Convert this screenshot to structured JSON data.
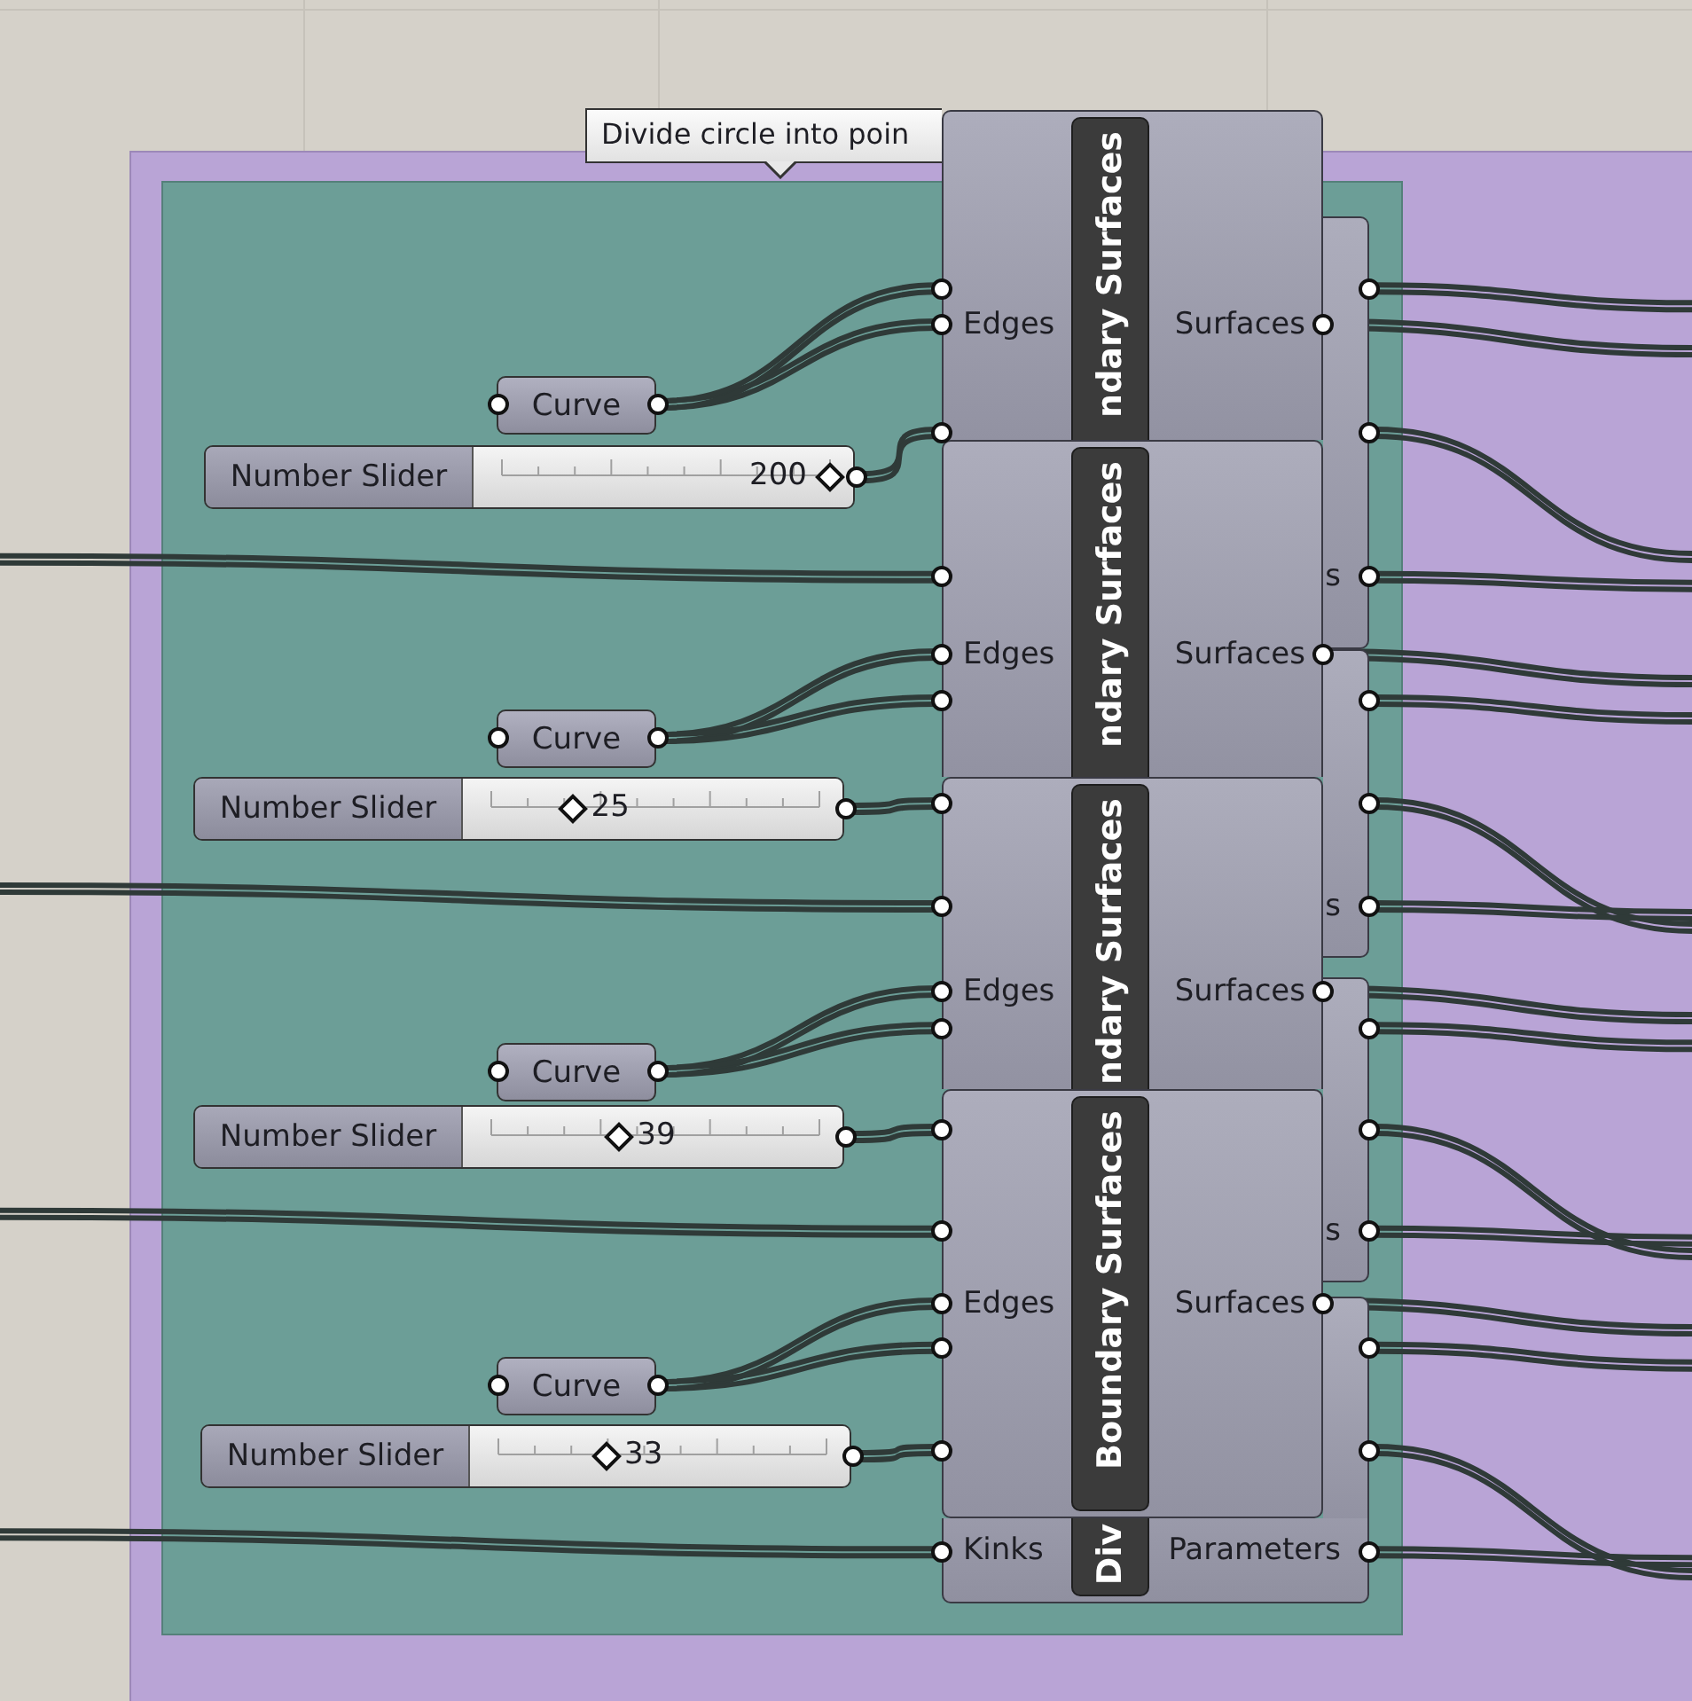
{
  "tooltip": {
    "text": "Divide circle into poin"
  },
  "groups": [
    {
      "kind": "outer",
      "color": "#b9a4d6"
    },
    {
      "kind": "inner",
      "color": "#6c9e97"
    }
  ],
  "inputs": [
    {
      "curve": "Curve",
      "slider": {
        "label": "Number Slider",
        "value": "200",
        "level": 1.0
      }
    },
    {
      "curve": "Curve",
      "slider": {
        "label": "Number Slider",
        "value": "25",
        "level": 0.25
      }
    },
    {
      "curve": "Curve",
      "slider": {
        "label": "Number Slider",
        "value": "39",
        "level": 0.39
      }
    },
    {
      "curve": "Curve",
      "slider": {
        "label": "Number Slider",
        "value": "33",
        "level": 0.33
      }
    }
  ],
  "divide_components": [
    {
      "output": "s"
    },
    {
      "output": "s"
    },
    {
      "output": "s"
    },
    {
      "title": "Div",
      "input": "Kinks",
      "output": "Parameters"
    }
  ],
  "boundary_components": [
    {
      "title": "ndary Surfaces",
      "input": "Edges",
      "output": "Surfaces"
    },
    {
      "title": "ndary Surfaces",
      "input": "Edges",
      "output": "Surfaces"
    },
    {
      "title": "ndary Surfaces",
      "input": "Edges",
      "output": "Surfaces"
    },
    {
      "title": "Boundary Surfaces",
      "input": "Edges",
      "output": "Surfaces"
    }
  ]
}
